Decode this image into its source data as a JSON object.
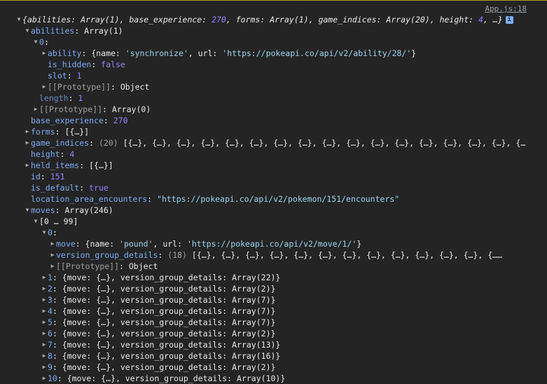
{
  "source_link": "App.js:18",
  "rows": [
    {
      "indent": 0,
      "arrow": "down",
      "segs": [
        {
          "t": "{",
          "c": "pl it"
        },
        {
          "t": "abilities",
          "c": "pl it"
        },
        {
          "t": ": ",
          "c": "pl it"
        },
        {
          "t": "Array(1)",
          "c": "pl it"
        },
        {
          "t": ", ",
          "c": "pl it"
        },
        {
          "t": "base_experience",
          "c": "pl it"
        },
        {
          "t": ": ",
          "c": "pl it"
        },
        {
          "t": "270",
          "c": "num it"
        },
        {
          "t": ", ",
          "c": "pl it"
        },
        {
          "t": "forms",
          "c": "pl it"
        },
        {
          "t": ": ",
          "c": "pl it"
        },
        {
          "t": "Array(1)",
          "c": "pl it"
        },
        {
          "t": ", ",
          "c": "pl it"
        },
        {
          "t": "game_indices",
          "c": "pl it"
        },
        {
          "t": ": ",
          "c": "pl it"
        },
        {
          "t": "Array(20)",
          "c": "pl it"
        },
        {
          "t": ", ",
          "c": "pl it"
        },
        {
          "t": "height",
          "c": "pl it"
        },
        {
          "t": ": ",
          "c": "pl it"
        },
        {
          "t": "4",
          "c": "num it"
        },
        {
          "t": ", …}",
          "c": "pl it"
        }
      ],
      "info": "i"
    },
    {
      "indent": 1,
      "arrow": "down",
      "segs": [
        {
          "t": "abilities",
          "c": "k"
        },
        {
          "t": ": Array(1)",
          "c": "pl"
        }
      ]
    },
    {
      "indent": 2,
      "arrow": "down",
      "segs": [
        {
          "t": "0",
          "c": "k"
        },
        {
          "t": ":",
          "c": "pl"
        }
      ]
    },
    {
      "indent": 3,
      "arrow": "right",
      "segs": [
        {
          "t": "ability",
          "c": "k"
        },
        {
          "t": ": {name: ",
          "c": "pl"
        },
        {
          "t": "'synchronize'",
          "c": "str"
        },
        {
          "t": ", url: ",
          "c": "pl"
        },
        {
          "t": "'https://pokeapi.co/api/v2/ability/28/'",
          "c": "str"
        },
        {
          "t": "}",
          "c": "pl"
        }
      ]
    },
    {
      "indent": 3,
      "arrow": "none",
      "segs": [
        {
          "t": "is_hidden",
          "c": "k"
        },
        {
          "t": ": ",
          "c": "pl"
        },
        {
          "t": "false",
          "c": "kw"
        }
      ]
    },
    {
      "indent": 3,
      "arrow": "none",
      "segs": [
        {
          "t": "slot",
          "c": "k"
        },
        {
          "t": ": ",
          "c": "pl"
        },
        {
          "t": "1",
          "c": "num"
        }
      ]
    },
    {
      "indent": 3,
      "arrow": "right",
      "segs": [
        {
          "t": "[[Prototype]]",
          "c": "grey"
        },
        {
          "t": ": Object",
          "c": "pl"
        }
      ]
    },
    {
      "indent": 2,
      "arrow": "none",
      "segs": [
        {
          "t": "length",
          "c": "kd"
        },
        {
          "t": ": ",
          "c": "pl"
        },
        {
          "t": "1",
          "c": "num"
        }
      ]
    },
    {
      "indent": 2,
      "arrow": "right",
      "segs": [
        {
          "t": "[[Prototype]]",
          "c": "grey"
        },
        {
          "t": ": Array(0)",
          "c": "pl"
        }
      ]
    },
    {
      "indent": 1,
      "arrow": "none",
      "segs": [
        {
          "t": "base_experience",
          "c": "k"
        },
        {
          "t": ": ",
          "c": "pl"
        },
        {
          "t": "270",
          "c": "num"
        }
      ]
    },
    {
      "indent": 1,
      "arrow": "right",
      "segs": [
        {
          "t": "forms",
          "c": "k"
        },
        {
          "t": ": [{…}]",
          "c": "pl"
        }
      ]
    },
    {
      "indent": 1,
      "arrow": "right",
      "segs": [
        {
          "t": "game_indices",
          "c": "k"
        },
        {
          "t": ": ",
          "c": "pl"
        },
        {
          "t": "(20)",
          "c": "grey"
        },
        {
          "t": " [{…}, {…}, {…}, {…}, {…}, {…}, {…}, {…}, {…}, {…}, {…}, {…}, {…}, {…}, {…}, {…}, {…",
          "c": "pl"
        }
      ]
    },
    {
      "indent": 1,
      "arrow": "none",
      "segs": [
        {
          "t": "height",
          "c": "k"
        },
        {
          "t": ": ",
          "c": "pl"
        },
        {
          "t": "4",
          "c": "num"
        }
      ]
    },
    {
      "indent": 1,
      "arrow": "right",
      "segs": [
        {
          "t": "held_items",
          "c": "k"
        },
        {
          "t": ": [{…}]",
          "c": "pl"
        }
      ]
    },
    {
      "indent": 1,
      "arrow": "none",
      "segs": [
        {
          "t": "id",
          "c": "k"
        },
        {
          "t": ": ",
          "c": "pl"
        },
        {
          "t": "151",
          "c": "num"
        }
      ]
    },
    {
      "indent": 1,
      "arrow": "none",
      "segs": [
        {
          "t": "is_default",
          "c": "k"
        },
        {
          "t": ": ",
          "c": "pl"
        },
        {
          "t": "true",
          "c": "kw"
        }
      ]
    },
    {
      "indent": 1,
      "arrow": "none",
      "segs": [
        {
          "t": "location_area_encounters",
          "c": "k"
        },
        {
          "t": ": ",
          "c": "pl"
        },
        {
          "t": "\"https://pokeapi.co/api/v2/pokemon/151/encounters\"",
          "c": "str"
        }
      ]
    },
    {
      "indent": 1,
      "arrow": "down",
      "segs": [
        {
          "t": "moves",
          "c": "k"
        },
        {
          "t": ": Array(246)",
          "c": "pl"
        }
      ]
    },
    {
      "indent": 2,
      "arrow": "down",
      "segs": [
        {
          "t": "[0 … 99]",
          "c": "pl"
        }
      ]
    },
    {
      "indent": 3,
      "arrow": "down",
      "segs": [
        {
          "t": "0",
          "c": "k"
        },
        {
          "t": ":",
          "c": "pl"
        }
      ]
    },
    {
      "indent": 4,
      "arrow": "right",
      "segs": [
        {
          "t": "move",
          "c": "k"
        },
        {
          "t": ": {name: ",
          "c": "pl"
        },
        {
          "t": "'pound'",
          "c": "str"
        },
        {
          "t": ", url: ",
          "c": "pl"
        },
        {
          "t": "'https://pokeapi.co/api/v2/move/1/'",
          "c": "str"
        },
        {
          "t": "}",
          "c": "pl"
        }
      ]
    },
    {
      "indent": 4,
      "arrow": "right",
      "segs": [
        {
          "t": "version_group_details",
          "c": "k"
        },
        {
          "t": ": ",
          "c": "pl"
        },
        {
          "t": "(18)",
          "c": "grey"
        },
        {
          "t": " [{…}, {…}, {…}, {…}, {…}, {…}, {…}, {…}, {…}, {…}, {…}, {…}, {……",
          "c": "pl"
        }
      ]
    },
    {
      "indent": 4,
      "arrow": "right",
      "segs": [
        {
          "t": "[[Prototype]]",
          "c": "grey"
        },
        {
          "t": ": Object",
          "c": "pl"
        }
      ]
    },
    {
      "indent": 3,
      "arrow": "right",
      "segs": [
        {
          "t": "1",
          "c": "k"
        },
        {
          "t": ": {move: {…}, version_group_details: Array(22)}",
          "c": "pl"
        }
      ]
    },
    {
      "indent": 3,
      "arrow": "right",
      "segs": [
        {
          "t": "2",
          "c": "k"
        },
        {
          "t": ": {move: {…}, version_group_details: Array(2)}",
          "c": "pl"
        }
      ]
    },
    {
      "indent": 3,
      "arrow": "right",
      "segs": [
        {
          "t": "3",
          "c": "k"
        },
        {
          "t": ": {move: {…}, version_group_details: Array(7)}",
          "c": "pl"
        }
      ]
    },
    {
      "indent": 3,
      "arrow": "right",
      "segs": [
        {
          "t": "4",
          "c": "k"
        },
        {
          "t": ": {move: {…}, version_group_details: Array(7)}",
          "c": "pl"
        }
      ]
    },
    {
      "indent": 3,
      "arrow": "right",
      "segs": [
        {
          "t": "5",
          "c": "k"
        },
        {
          "t": ": {move: {…}, version_group_details: Array(7)}",
          "c": "pl"
        }
      ]
    },
    {
      "indent": 3,
      "arrow": "right",
      "segs": [
        {
          "t": "6",
          "c": "k"
        },
        {
          "t": ": {move: {…}, version_group_details: Array(2)}",
          "c": "pl"
        }
      ]
    },
    {
      "indent": 3,
      "arrow": "right",
      "segs": [
        {
          "t": "7",
          "c": "k"
        },
        {
          "t": ": {move: {…}, version_group_details: Array(13)}",
          "c": "pl"
        }
      ]
    },
    {
      "indent": 3,
      "arrow": "right",
      "segs": [
        {
          "t": "8",
          "c": "k"
        },
        {
          "t": ": {move: {…}, version_group_details: Array(16)}",
          "c": "pl"
        }
      ]
    },
    {
      "indent": 3,
      "arrow": "right",
      "segs": [
        {
          "t": "9",
          "c": "k"
        },
        {
          "t": ": {move: {…}, version_group_details: Array(2)}",
          "c": "pl"
        }
      ]
    },
    {
      "indent": 3,
      "arrow": "right",
      "segs": [
        {
          "t": "10",
          "c": "k"
        },
        {
          "t": ": {move: {…}, version_group_details: Array(10)}",
          "c": "pl"
        }
      ]
    }
  ]
}
